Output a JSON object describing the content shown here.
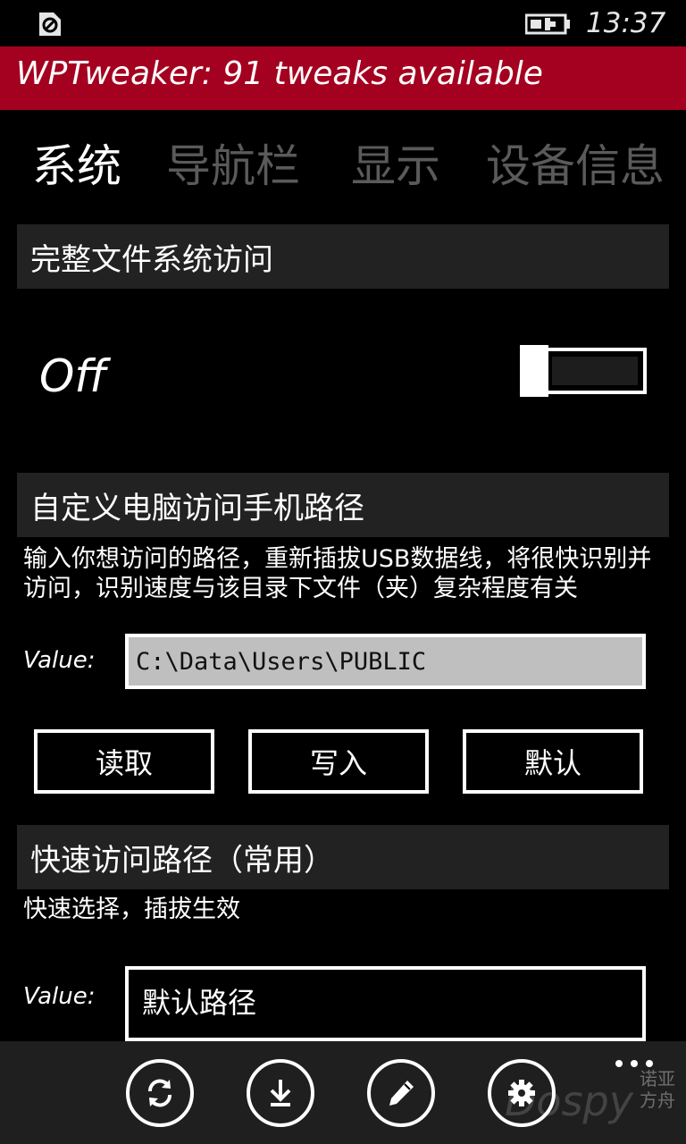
{
  "status_bar": {
    "time": "13:37",
    "left_icon": "data-sense-icon",
    "battery_icon": "battery-charging-icon"
  },
  "app_title": "WPTweaker: 91 tweaks available",
  "tabs": [
    {
      "label": "系统",
      "active": true
    },
    {
      "label": "导航栏",
      "active": false
    },
    {
      "label": "显示",
      "active": false
    },
    {
      "label": "设备信息",
      "active": false
    }
  ],
  "full_fs_access": {
    "header": "完整文件系统访问",
    "toggle_label": "Off",
    "toggle_on": false
  },
  "custom_path": {
    "header": "自定义电脑访问手机路径",
    "description": "输入你想访问的路径，重新插拔USB数据线，将很快识别并访问，识别速度与该目录下文件（夹）复杂程度有关",
    "value_label": "Value:",
    "value": "C:\\Data\\Users\\PUBLIC",
    "buttons": {
      "read": "读取",
      "write": "写入",
      "default": "默认"
    }
  },
  "quick_path": {
    "header": "快速访问路径（常用）",
    "description": "快速选择，插拔生效",
    "value_label": "Value:",
    "selected": "默认路径"
  },
  "app_bar": {
    "buttons": [
      "refresh-icon",
      "download-icon",
      "edit-icon",
      "settings-icon"
    ],
    "more": "more-icon"
  },
  "watermark": {
    "brand": "Dospy",
    "small_line1": "诺亚",
    "small_line2": "方舟"
  },
  "colors": {
    "accent": "#a4001f",
    "header_bg": "#222222",
    "input_bg": "#bfbfbf",
    "appbar_bg": "#1f1f1f"
  }
}
